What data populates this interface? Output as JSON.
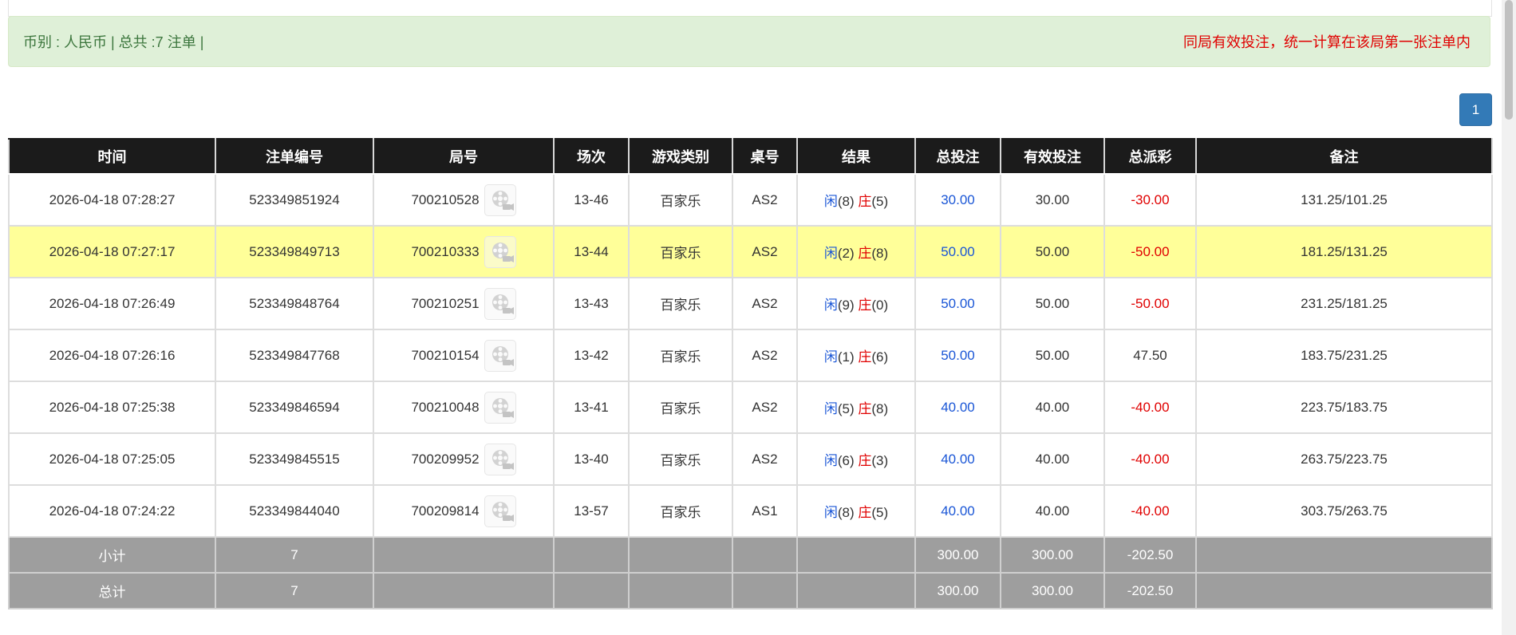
{
  "info_bar": {
    "summary": "币别 : 人民币 | 总共 :7 注单 |",
    "notice": "同局有效投注，统一计算在该局第一张注单内"
  },
  "pagination": {
    "current_page": "1"
  },
  "table": {
    "headers": [
      "时间",
      "注单编号",
      "局号",
      "场次",
      "游戏类别",
      "桌号",
      "结果",
      "总投注",
      "有效投注",
      "总派彩",
      "备注"
    ],
    "rows": [
      {
        "time": "2026-04-18 07:28:27",
        "bet_id": "523349851924",
        "round": "700210528",
        "session": "13-46",
        "game": "百家乐",
        "table": "AS2",
        "player_label": "闲",
        "player_value": "(8)",
        "banker_label": "庄",
        "banker_value": "(5)",
        "total_bet": "30.00",
        "valid_bet": "30.00",
        "payout": "-30.00",
        "payout_negative": true,
        "note": "131.25/101.25",
        "highlight": false
      },
      {
        "time": "2026-04-18 07:27:17",
        "bet_id": "523349849713",
        "round": "700210333",
        "session": "13-44",
        "game": "百家乐",
        "table": "AS2",
        "player_label": "闲",
        "player_value": "(2)",
        "banker_label": "庄",
        "banker_value": "(8)",
        "total_bet": "50.00",
        "valid_bet": "50.00",
        "payout": "-50.00",
        "payout_negative": true,
        "note": "181.25/131.25",
        "highlight": true
      },
      {
        "time": "2026-04-18 07:26:49",
        "bet_id": "523349848764",
        "round": "700210251",
        "session": "13-43",
        "game": "百家乐",
        "table": "AS2",
        "player_label": "闲",
        "player_value": "(9)",
        "banker_label": "庄",
        "banker_value": "(0)",
        "total_bet": "50.00",
        "valid_bet": "50.00",
        "payout": "-50.00",
        "payout_negative": true,
        "note": "231.25/181.25",
        "highlight": false
      },
      {
        "time": "2026-04-18 07:26:16",
        "bet_id": "523349847768",
        "round": "700210154",
        "session": "13-42",
        "game": "百家乐",
        "table": "AS2",
        "player_label": "闲",
        "player_value": "(1)",
        "banker_label": "庄",
        "banker_value": "(6)",
        "total_bet": "50.00",
        "valid_bet": "50.00",
        "payout": "47.50",
        "payout_negative": false,
        "note": "183.75/231.25",
        "highlight": false
      },
      {
        "time": "2026-04-18 07:25:38",
        "bet_id": "523349846594",
        "round": "700210048",
        "session": "13-41",
        "game": "百家乐",
        "table": "AS2",
        "player_label": "闲",
        "player_value": "(5)",
        "banker_label": "庄",
        "banker_value": "(8)",
        "total_bet": "40.00",
        "valid_bet": "40.00",
        "payout": "-40.00",
        "payout_negative": true,
        "note": "223.75/183.75",
        "highlight": false
      },
      {
        "time": "2026-04-18 07:25:05",
        "bet_id": "523349845515",
        "round": "700209952",
        "session": "13-40",
        "game": "百家乐",
        "table": "AS2",
        "player_label": "闲",
        "player_value": "(6)",
        "banker_label": "庄",
        "banker_value": "(3)",
        "total_bet": "40.00",
        "valid_bet": "40.00",
        "payout": "-40.00",
        "payout_negative": true,
        "note": "263.75/223.75",
        "highlight": false
      },
      {
        "time": "2026-04-18 07:24:22",
        "bet_id": "523349844040",
        "round": "700209814",
        "session": "13-57",
        "game": "百家乐",
        "table": "AS1",
        "player_label": "闲",
        "player_value": "(8)",
        "banker_label": "庄",
        "banker_value": "(5)",
        "total_bet": "40.00",
        "valid_bet": "40.00",
        "payout": "-40.00",
        "payout_negative": true,
        "note": "303.75/263.75",
        "highlight": false
      }
    ],
    "subtotal": {
      "label": "小计",
      "count": "7",
      "total_bet": "300.00",
      "valid_bet": "300.00",
      "payout": "-202.50"
    },
    "total": {
      "label": "总计",
      "count": "7",
      "total_bet": "300.00",
      "valid_bet": "300.00",
      "payout": "-202.50"
    }
  },
  "colors": {
    "player": "#1a56d6",
    "banker": "#e00000",
    "negative_payout": "#e00000",
    "highlight_row": "#ffff99",
    "header_bg": "#1b1b1b",
    "footer_bg": "#9e9e9e",
    "info_bg": "#dff0d8",
    "pager_bg": "#337ab7"
  },
  "icons": {
    "round_replay": "film-reel-icon"
  }
}
